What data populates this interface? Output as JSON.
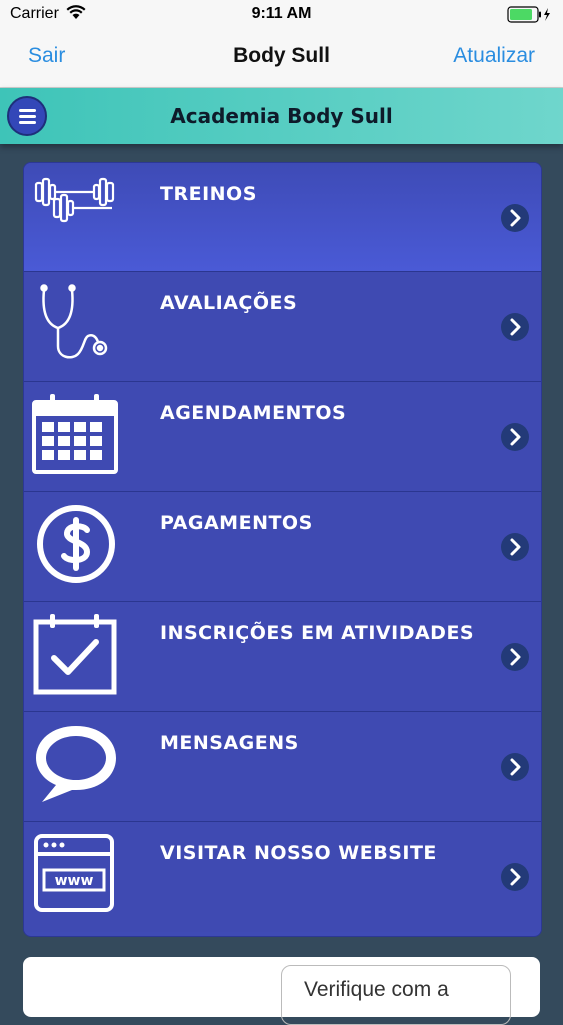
{
  "status_bar": {
    "carrier": "Carrier",
    "time": "9:11 AM"
  },
  "nav": {
    "left": "Sair",
    "title": "Body Sull",
    "right": "Atualizar"
  },
  "sub_header": {
    "title": "Academia Body Sull"
  },
  "menu": [
    {
      "label": "TREINOS",
      "icon": "dumbbell-icon"
    },
    {
      "label": "AVALIAÇÕES",
      "icon": "stethoscope-icon"
    },
    {
      "label": "AGENDAMENTOS",
      "icon": "calendar-icon"
    },
    {
      "label": "PAGAMENTOS",
      "icon": "dollar-icon"
    },
    {
      "label": "INSCRIÇÕES EM ATIVIDADES",
      "icon": "calendar-check-icon"
    },
    {
      "label": "MENSAGENS",
      "icon": "speech-bubble-icon"
    },
    {
      "label": "VISITAR NOSSO WEBSITE",
      "icon": "browser-www-icon"
    }
  ],
  "bottom": {
    "notice": "Verifique com a"
  },
  "colors": {
    "accent": "#2a8de0",
    "teal": "#3ec4b8",
    "menu_bg": "#3f4ab2"
  }
}
